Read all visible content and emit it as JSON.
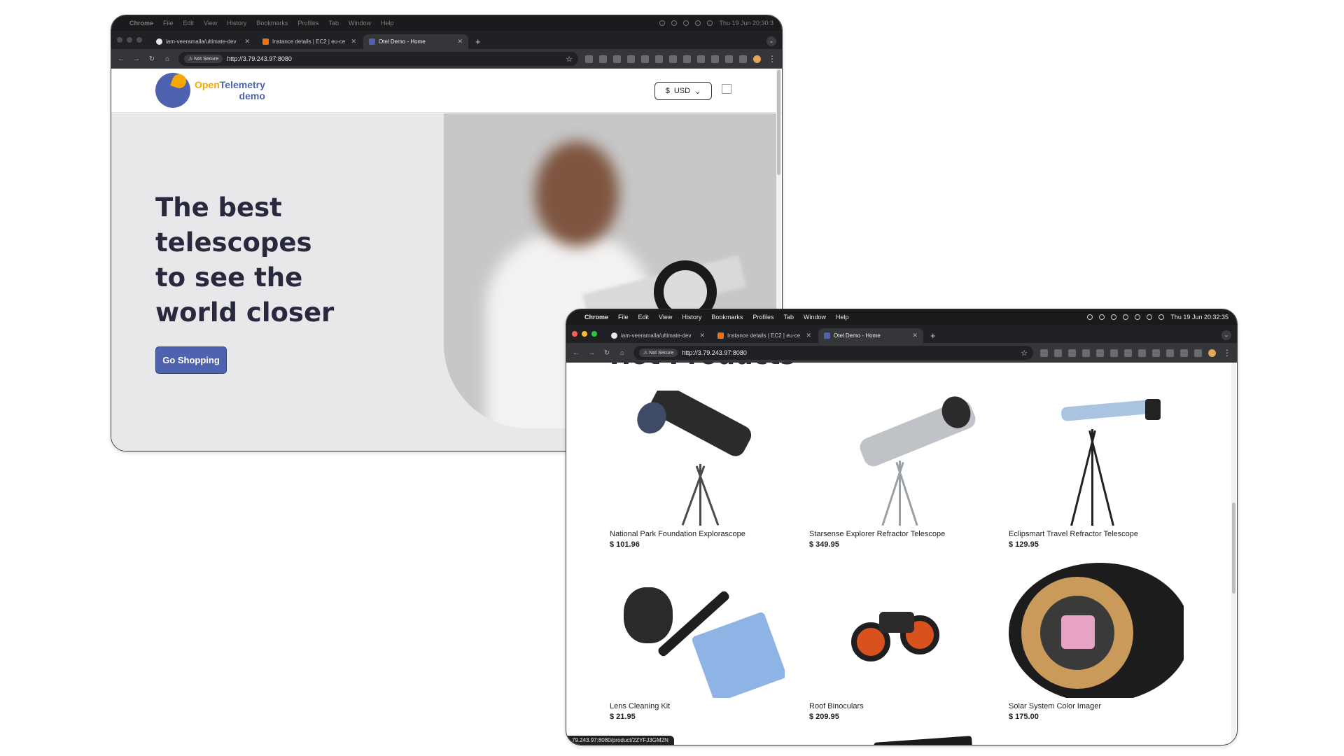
{
  "menu": {
    "app": "Chrome",
    "items": [
      "File",
      "Edit",
      "View",
      "History",
      "Bookmarks",
      "Profiles",
      "Tab",
      "Window",
      "Help"
    ],
    "clock_a": "Thu 19 Jun  20:30:3",
    "clock_b": "Thu 19 Jun  20:32:35"
  },
  "browser": {
    "tabs": [
      {
        "title": "iam-veeramalla/ultimate-dev",
        "icon": "github-icon"
      },
      {
        "title": "Instance details | EC2 | eu-ce",
        "icon": "aws-icon"
      },
      {
        "title": "Otel Demo - Home",
        "icon": "otel-icon"
      }
    ],
    "new_tab": "+",
    "not_secure": "Not Secure",
    "url": "http://3.79.243.97:8080"
  },
  "site": {
    "logo_line1a": "Open",
    "logo_line1b": "Telemetry",
    "logo_line2": "demo",
    "currency_symbol": "$",
    "currency": "USD",
    "hero_title": "The best telescopes to see the world closer",
    "cta": "Go Shopping",
    "hot_products": "Hot Products"
  },
  "products": [
    {
      "name": "National Park Foundation Explorascope",
      "price": "$ 101.96"
    },
    {
      "name": "Starsense Explorer Refractor Telescope",
      "price": "$ 349.95"
    },
    {
      "name": "Eclipsmart Travel Refractor Telescope",
      "price": "$ 129.95"
    },
    {
      "name": "Lens Cleaning Kit",
      "price": "$ 21.95"
    },
    {
      "name": "Roof Binoculars",
      "price": "$ 209.95"
    },
    {
      "name": "Solar System Color Imager",
      "price": "$ 175.00"
    }
  ],
  "status_url": "79.243.97:8080/product/2ZYFJ3GM2N",
  "colors": {
    "brand_blue": "#4f62b0",
    "brand_orange": "#f5a800",
    "hero_bg": "#e8e8eb",
    "heading": "#29293e"
  }
}
